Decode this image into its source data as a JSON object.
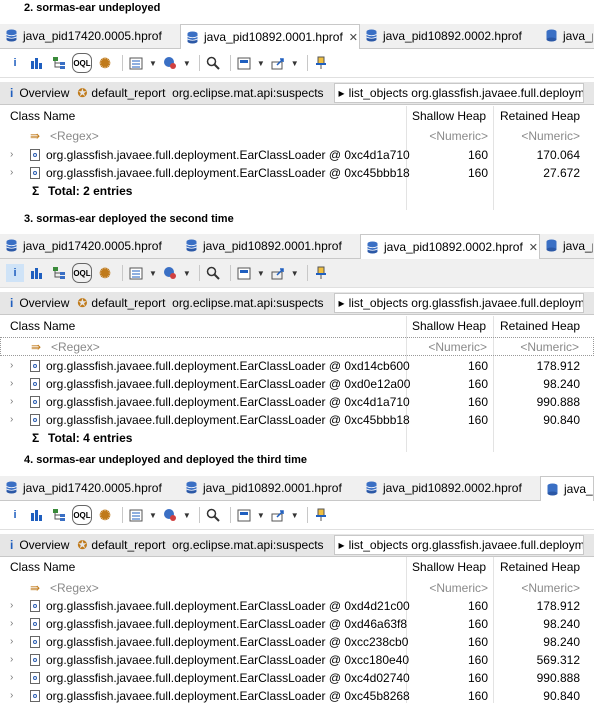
{
  "sections": [
    {
      "caption": "2. sormas-ear undeployed",
      "tabs": [
        "java_pid17420.0005.hprof",
        "java_pid10892.0001.hprof",
        "java_pid10892.0002.hprof",
        "java_pid"
      ],
      "active_tab": 1,
      "subtabs": [
        "Overview",
        "default_report  org.eclipse.mat.api:suspects",
        "list_objects org.glassfish.javaee.full.deploym"
      ],
      "columns": {
        "class_name": "Class Name",
        "shallow": "Shallow Heap",
        "retained": "Retained Heap"
      },
      "filter": {
        "regex": "<Regex>",
        "numeric1": "<Numeric>",
        "numeric2": "<Numeric>"
      },
      "rows": [
        {
          "name": "org.glassfish.javaee.full.deployment.EarClassLoader @ 0xc4d1a710",
          "shallow": "160",
          "retained": "170.064"
        },
        {
          "name": "org.glassfish.javaee.full.deployment.EarClassLoader @ 0xc45bbb18",
          "shallow": "160",
          "retained": "27.672"
        }
      ],
      "total": "Total: 2 entries"
    },
    {
      "caption": "3. sormas-ear deployed the second time",
      "tabs": [
        "java_pid17420.0005.hprof",
        "java_pid10892.0001.hprof",
        "java_pid10892.0002.hprof",
        "java_pid"
      ],
      "active_tab": 2,
      "subtabs": [
        "Overview",
        "default_report  org.eclipse.mat.api:suspects",
        "list_objects org.glassfish.javaee.full.deploym"
      ],
      "columns": {
        "class_name": "Class Name",
        "shallow": "Shallow Heap",
        "retained": "Retained Heap"
      },
      "filter": {
        "regex": "<Regex>",
        "numeric1": "<Numeric>",
        "numeric2": "<Numeric>"
      },
      "rows": [
        {
          "name": "org.glassfish.javaee.full.deployment.EarClassLoader @ 0xd14cb600",
          "shallow": "160",
          "retained": "178.912"
        },
        {
          "name": "org.glassfish.javaee.full.deployment.EarClassLoader @ 0xd0e12a00",
          "shallow": "160",
          "retained": "98.240"
        },
        {
          "name": "org.glassfish.javaee.full.deployment.EarClassLoader @ 0xc4d1a710",
          "shallow": "160",
          "retained": "990.888"
        },
        {
          "name": "org.glassfish.javaee.full.deployment.EarClassLoader @ 0xc45bbb18",
          "shallow": "160",
          "retained": "90.840"
        }
      ],
      "total": "Total: 4 entries"
    },
    {
      "caption": "4. sormas-ear undeployed and deployed the third time",
      "tabs": [
        "java_pid17420.0005.hprof",
        "java_pid10892.0001.hprof",
        "java_pid10892.0002.hprof",
        "java_pid"
      ],
      "active_tab": 3,
      "subtabs": [
        "Overview",
        "default_report  org.eclipse.mat.api:suspects",
        "list_objects org.glassfish.javaee.full.deploym"
      ],
      "columns": {
        "class_name": "Class Name",
        "shallow": "Shallow Heap",
        "retained": "Retained Heap"
      },
      "filter": {
        "regex": "<Regex>",
        "numeric1": "<Numeric>",
        "numeric2": "<Numeric>"
      },
      "rows": [
        {
          "name": "org.glassfish.javaee.full.deployment.EarClassLoader @ 0xd4d21c00",
          "shallow": "160",
          "retained": "178.912"
        },
        {
          "name": "org.glassfish.javaee.full.deployment.EarClassLoader @ 0xd46a63f8",
          "shallow": "160",
          "retained": "98.240"
        },
        {
          "name": "org.glassfish.javaee.full.deployment.EarClassLoader @ 0xcc238cb0",
          "shallow": "160",
          "retained": "98.240"
        },
        {
          "name": "org.glassfish.javaee.full.deployment.EarClassLoader @ 0xcc180e40",
          "shallow": "160",
          "retained": "569.312"
        },
        {
          "name": "org.glassfish.javaee.full.deployment.EarClassLoader @ 0xc4d02740",
          "shallow": "160",
          "retained": "990.888"
        },
        {
          "name": "org.glassfish.javaee.full.deployment.EarClassLoader @ 0xc45b8268",
          "shallow": "160",
          "retained": "90.840"
        }
      ],
      "total": ""
    }
  ],
  "toolbar_icons": [
    "info-icon",
    "histogram-icon",
    "dominator-tree-icon",
    "oql-icon",
    "thread-icon",
    "query-browser-icon",
    "heap-dump-overview-icon",
    "search-icon",
    "group-icon",
    "export-icon",
    "pin-icon"
  ]
}
